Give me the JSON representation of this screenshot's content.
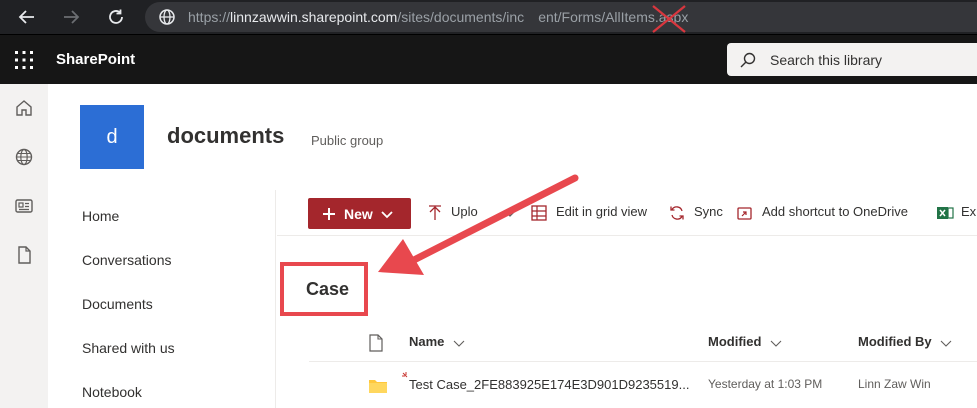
{
  "browser": {
    "url_scheme": "https://",
    "url_host": "linnzawwin.sharepoint.com",
    "url_path_before": "/sites/documents/inc",
    "url_path_after": "ent/Forms/AllItems.aspx"
  },
  "suite": {
    "app_name": "SharePoint",
    "search_placeholder": "Search this library"
  },
  "site": {
    "logo_letter": "d",
    "title": "documents",
    "subtitle": "Public group"
  },
  "left_nav": {
    "items": [
      {
        "label": "Home"
      },
      {
        "label": "Conversations"
      },
      {
        "label": "Documents"
      },
      {
        "label": "Shared with us"
      },
      {
        "label": "Notebook"
      }
    ]
  },
  "command_bar": {
    "new_label": "New",
    "upload_label": "Uplo",
    "grid_view_label": "Edit in grid view",
    "sync_label": "Sync",
    "shortcut_label": "Add shortcut to OneDrive",
    "export_label": "Exp"
  },
  "library": {
    "title": "Case"
  },
  "table": {
    "columns": {
      "name": "Name",
      "modified": "Modified",
      "modified_by": "Modified By"
    },
    "rows": [
      {
        "name": "Test Case_2FE883925E174E3D901D9235519...",
        "modified": "Yesterday at 1:03 PM",
        "modified_by": "Linn Zaw Win"
      }
    ]
  },
  "colors": {
    "suite_bar": "#161616",
    "accent": "#a4262c",
    "site_logo": "#2c6ed5",
    "annotation": "#e8484e"
  }
}
